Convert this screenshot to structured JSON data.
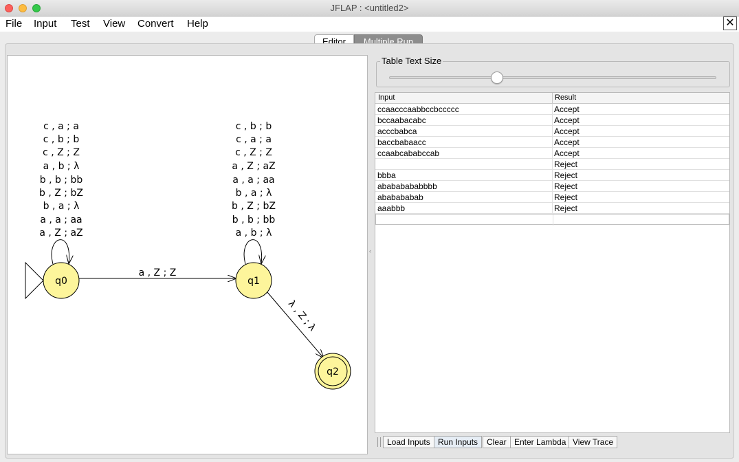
{
  "window": {
    "title": "JFLAP : <untitled2>"
  },
  "menu": [
    "File",
    "Input",
    "Test",
    "View",
    "Convert",
    "Help"
  ],
  "menu_close_glyph": "✕",
  "tabs": [
    "Editor",
    "Multiple Run"
  ],
  "active_tab": "Multiple Run",
  "automaton": {
    "states": [
      "q0",
      "q1",
      "q2"
    ],
    "initial_state": "q0",
    "final_states": [
      "q2"
    ],
    "loops": {
      "q0": [
        "c , a ; a",
        "c , b ; b",
        "c , Z ; Z",
        "a , b ; λ",
        "b , b ; bb",
        "b , Z ; bZ",
        "b , a ; λ",
        "a , a ; aa",
        "a , Z ; aZ"
      ],
      "q1": [
        "c , b ; b",
        "c , a ; a",
        "c , Z ; Z",
        "a , Z ; aZ",
        "a , a ; aa",
        "b , a ; λ",
        "b , Z ; bZ",
        "b , b ; bb",
        "a , b ; λ"
      ]
    },
    "transitions": [
      {
        "from": "q0",
        "to": "q1",
        "label": "a , Z ; Z"
      },
      {
        "from": "q1",
        "to": "q2",
        "label": "λ , Z ; λ"
      }
    ]
  },
  "table_text_size": {
    "title": "Table Text Size",
    "slider_fraction": 0.33
  },
  "table": {
    "columns": [
      "Input",
      "Result"
    ],
    "rows": [
      {
        "input": "ccaacccaabbccbccccc",
        "result": "Accept"
      },
      {
        "input": "bccaabacabc",
        "result": "Accept"
      },
      {
        "input": "acccbabca",
        "result": "Accept"
      },
      {
        "input": "baccbabaacc",
        "result": "Accept"
      },
      {
        "input": "ccaabcababccab",
        "result": "Accept"
      },
      {
        "input": "",
        "result": "Reject"
      },
      {
        "input": "bbba",
        "result": "Reject"
      },
      {
        "input": "abababababbbb",
        "result": "Reject"
      },
      {
        "input": "ababababab",
        "result": "Reject"
      },
      {
        "input": "aaabbb",
        "result": "Reject"
      }
    ]
  },
  "buttons": {
    "load": "Load Inputs",
    "run": "Run Inputs",
    "clear": "Clear",
    "lambda": "Enter Lambda",
    "trace": "View Trace"
  }
}
